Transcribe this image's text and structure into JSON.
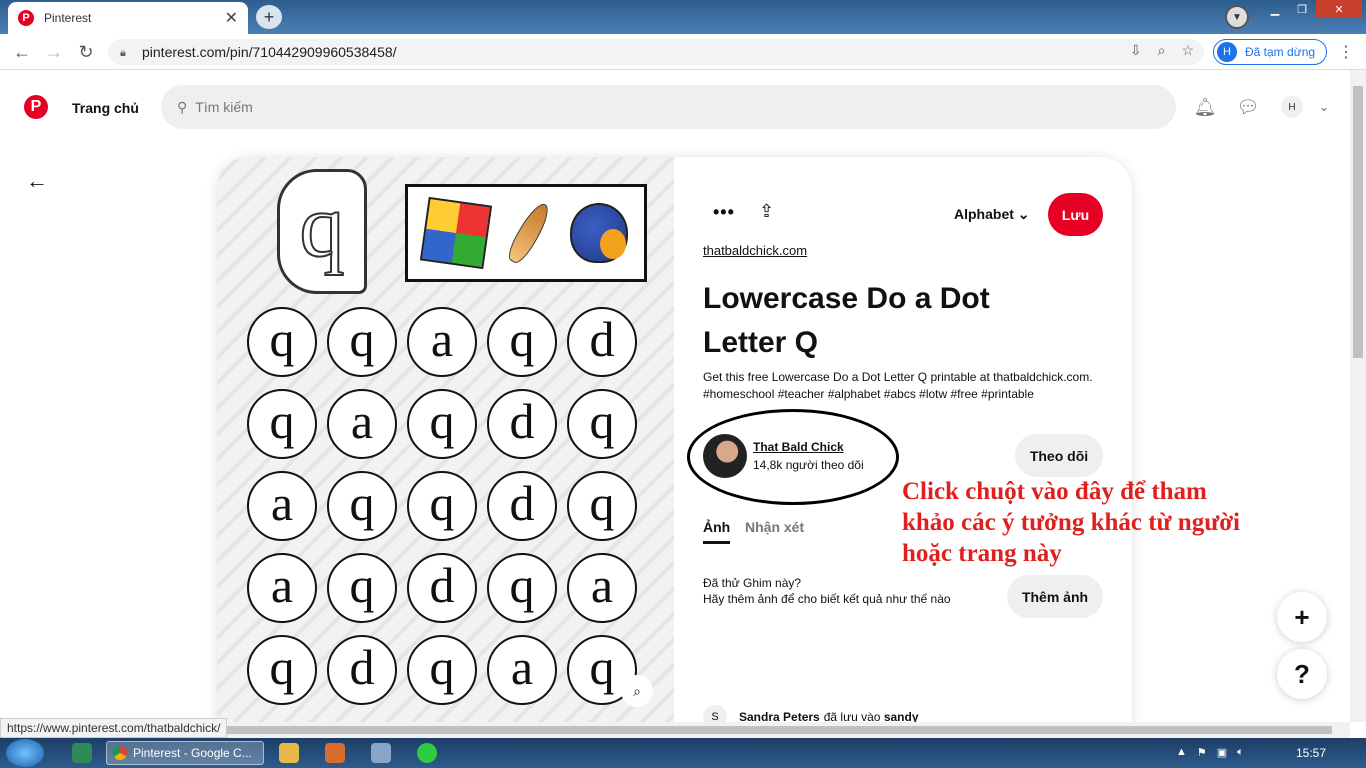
{
  "browser": {
    "tab_title": "Pinterest",
    "tab_favicon": "P",
    "url": "pinterest.com/pin/710442909960538458/",
    "profile_initial": "H",
    "profile_status": "Đã tạm dừng",
    "status_url": "https://www.pinterest.com/thatbaldchick/"
  },
  "header": {
    "logo": "P",
    "home_label": "Trang chủ",
    "search_placeholder": "Tìm kiếm",
    "user_initial": "H"
  },
  "pin": {
    "image": {
      "big_letter": "q",
      "grid_letters": [
        "q",
        "q",
        "a",
        "q",
        "d",
        "q",
        "a",
        "q",
        "d",
        "q",
        "a",
        "q",
        "q",
        "d",
        "q",
        "a",
        "q",
        "d",
        "q",
        "a",
        "q",
        "d",
        "q",
        "a",
        "q"
      ]
    },
    "board": "Alphabet",
    "save_label": "Lưu",
    "source": "thatbaldchick.com",
    "title": "Lowercase Do a Dot Letter Q",
    "description": "Get this free Lowercase Do a Dot Letter Q printable at thatbaldchick.com. #homeschool #teacher #alphabet #abcs #lotw #free #printable",
    "creator": {
      "name": "That Bald Chick",
      "followers": "14,8k người theo dõi"
    },
    "follow_label": "Theo dõi",
    "tabs": [
      "Ảnh",
      "Nhận xét"
    ],
    "tried_line1": "Đã thử Ghim này?",
    "tried_line2": "Hãy thêm ảnh để cho biết kết quả như thế nào",
    "add_photo_label": "Thêm ảnh",
    "saver": {
      "initial": "S",
      "name": "Sandra Peters",
      "action": "đã lưu vào",
      "board": "sandy"
    }
  },
  "annotation": "Click chuột vào đây để tham khảo các ý tưởng khác từ người  hoặc trang này",
  "fab": {
    "add": "+",
    "help": "?"
  },
  "taskbar": {
    "active_task": "Pinterest - Google C...",
    "clock": "15:57"
  }
}
